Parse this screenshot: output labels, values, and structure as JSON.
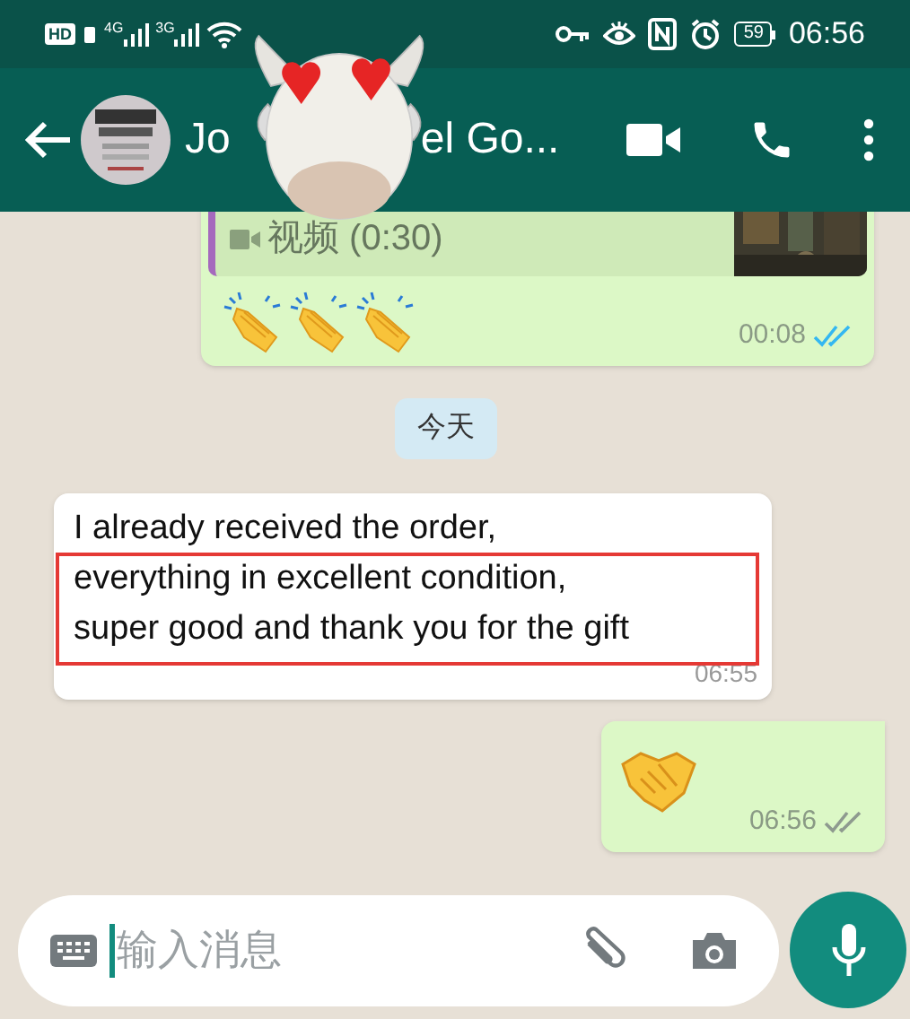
{
  "status_bar": {
    "hd": "HD",
    "sim1": "4G",
    "sim2": "3G",
    "battery": "59",
    "time": "06:56"
  },
  "header": {
    "name_parts": [
      "Jo",
      "el Go..."
    ]
  },
  "messages": [
    {
      "kind": "sent_quote",
      "quote": "视频 (0:30)",
      "time": "00:08",
      "read": true
    },
    {
      "kind": "date",
      "text": "今天"
    },
    {
      "kind": "received",
      "text": "I already received the order,\neverything in excellent condition,\nsuper good and thank you for the gift",
      "time": "06:55",
      "highlighted": true
    },
    {
      "kind": "sent_emoji",
      "time": "06:56",
      "read": false
    }
  ],
  "composer": {
    "placeholder": "输入消息"
  }
}
